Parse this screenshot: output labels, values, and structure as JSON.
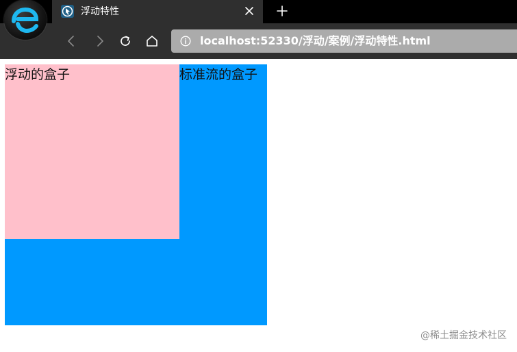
{
  "tab": {
    "title": "浮动特性"
  },
  "address_bar": {
    "url": "localhost:52330/浮动/案例/浮动特性.html"
  },
  "page": {
    "float_box_label": "浮动的盒子",
    "normal_box_label": "标准流的盒子"
  },
  "watermark": "@稀土掘金技术社区",
  "icons": {
    "browser_logo": "browser-logo-icon",
    "favicon": "favicon-icon",
    "tab_close": "close-icon",
    "new_tab": "plus-icon",
    "back": "chevron-left-icon",
    "forward": "chevron-right-icon",
    "reload": "reload-icon",
    "home": "home-icon",
    "site_info": "info-icon"
  },
  "colors": {
    "float_box": "#ffc0cb",
    "normal_box": "#0099ff",
    "toolbar": "#2f2f2f",
    "address_bar": "#ababab"
  }
}
